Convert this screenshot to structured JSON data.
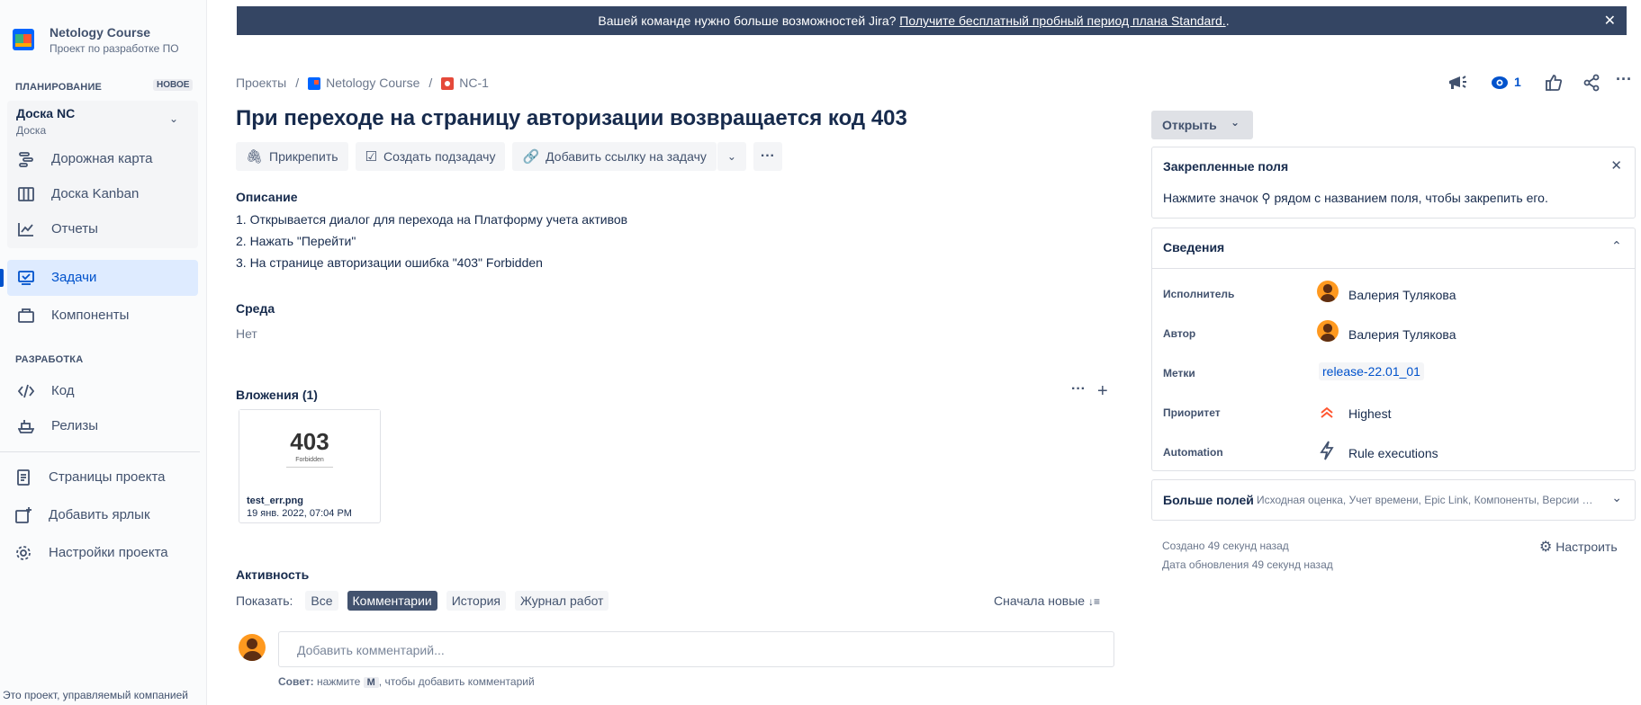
{
  "sidebar": {
    "project_name": "Netology Course",
    "project_type": "Проект по разработке ПО",
    "planning_label": "ПЛАНИРОВАНИЕ",
    "new_badge": "НОВОЕ",
    "board_title": "Доска NC",
    "board_subtitle": "Доска",
    "planning_items": [
      {
        "label": "Дорожная карта",
        "icon": "roadmap-icon"
      },
      {
        "label": "Доска Kanban",
        "icon": "board-icon"
      },
      {
        "label": "Отчеты",
        "icon": "reports-icon"
      },
      {
        "label": "Задачи",
        "icon": "issues-icon"
      },
      {
        "label": "Компоненты",
        "icon": "components-icon"
      }
    ],
    "dev_label": "РАЗРАБОТКА",
    "dev_items": [
      {
        "label": "Код",
        "icon": "code-icon"
      },
      {
        "label": "Релизы",
        "icon": "releases-icon"
      }
    ],
    "bottom_items": [
      {
        "label": "Страницы проекта",
        "icon": "page-icon"
      },
      {
        "label": "Добавить ярлык",
        "icon": "add-shortcut-icon"
      },
      {
        "label": "Настройки проекта",
        "icon": "gear-icon"
      }
    ],
    "footer": "Это проект, управляемый компанией"
  },
  "banner": {
    "text": "Вашей команде нужно больше возможностей Jira?",
    "link": "Получите бесплатный пробный период плана Standard.",
    "suffix": "."
  },
  "breadcrumbs": {
    "projects": "Проекты",
    "project": "Netology Course",
    "issue_key": "NC-1"
  },
  "watchers_count": "1",
  "issue": {
    "title": "При переходе на страницу авторизации возвращается код 403",
    "toolbar": {
      "attach": "Прикрепить",
      "subtask": "Создать подзадачу",
      "link": "Добавить ссылку на задачу"
    },
    "description_label": "Описание",
    "description_lines": [
      "1. Открывается диалог для перехода на Платформу учета активов",
      "2. Нажать \"Перейти\"",
      "3. На странице авторизации ошибка \"403\" Forbidden"
    ],
    "environment_label": "Среда",
    "environment_value": "Нет",
    "attachments_label": "Вложения (1)",
    "attachment": {
      "thumb_code": "403",
      "thumb_text": "Forbidden",
      "filename": "test_err.png",
      "date": "19 янв. 2022, 07:04 PM"
    }
  },
  "activity": {
    "label": "Активность",
    "show_label": "Показать:",
    "filters": [
      "Все",
      "Комментарии",
      "История",
      "Журнал работ"
    ],
    "selected": "Комментарии",
    "sort": "Сначала новые",
    "comment_placeholder": "Добавить комментарий...",
    "tip_bold": "Совет:",
    "tip_pre": "нажмите",
    "tip_key": "M",
    "tip_post": ", чтобы добавить комментарий"
  },
  "right": {
    "status": "Открыть",
    "pinned_title": "Закрепленные поля",
    "pinned_text": "Нажмите значок ⚲ рядом с названием поля, чтобы закрепить его.",
    "details_title": "Сведения",
    "fields": [
      {
        "label": "Исполнитель",
        "value": "Валерия Тулякова"
      },
      {
        "label": "Автор",
        "value": "Валерия Тулякова"
      },
      {
        "label": "Метки",
        "value": "release-22.01_01"
      },
      {
        "label": "Приоритет",
        "value": "Highest"
      },
      {
        "label": "Automation",
        "value": "Rule executions"
      }
    ],
    "more_fields_title": "Больше полей",
    "more_fields_list": "Исходная оценка, Учет времени, Epic Link, Компоненты, Версии …",
    "created": "Создано 49 секунд назад",
    "updated": "Дата обновления 49 секунд назад",
    "configure": "Настроить"
  },
  "colors": {
    "banner_bg": "#344563",
    "active_nav": "#deebff",
    "accent": "#0052cc",
    "priority": "#ff5630",
    "avatar": "#ff991f"
  }
}
